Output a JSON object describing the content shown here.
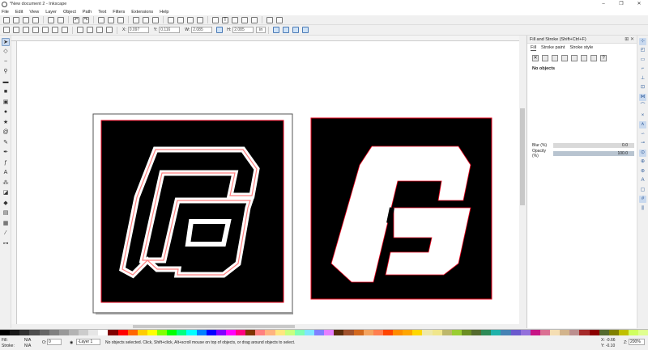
{
  "window": {
    "title": "*New document 2 - Inkscape",
    "min": "–",
    "max": "❐",
    "close": "✕"
  },
  "menu": [
    "File",
    "Edit",
    "View",
    "Layer",
    "Object",
    "Path",
    "Text",
    "Filters",
    "Extensions",
    "Help"
  ],
  "controls": {
    "x_label": "X:",
    "x_value": "0.097",
    "y_label": "Y:",
    "y_value": "0.116",
    "w_label": "W:",
    "w_value": "2.085",
    "h_label": "H:",
    "h_value": "2.085",
    "unit": "in"
  },
  "dock": {
    "title": "Fill and Stroke (Shift+Ctrl+F)",
    "tabs": [
      "Fill",
      "Stroke paint",
      "Stroke style"
    ],
    "no_objects": "No objects",
    "blur_label": "Blur (%)",
    "blur_value": "0.0",
    "opacity_label": "Opacity (%)",
    "opacity_value": "100.0"
  },
  "status": {
    "fill_label": "Fill:",
    "fill_value": "N/A",
    "stroke_label": "Stroke:",
    "stroke_value": "N/A",
    "o_label": "O:",
    "o_value": "0",
    "layer": "-Layer 1",
    "message": "No objects selected. Click, Shift+click, Alt+scroll mouse on top of objects, or drag around objects to select.",
    "x_coord": "X: -0.66",
    "y_coord": "Y: -0.10",
    "z_label": "Z:",
    "zoom": "200%"
  },
  "colors": {
    "accent": "#4a7ab6",
    "stroke_red": "#e8001c",
    "canvas": "#ffffff"
  },
  "palette": [
    "#000000",
    "#1a1a1a",
    "#333333",
    "#4d4d4d",
    "#666666",
    "#808080",
    "#999999",
    "#b3b3b3",
    "#cccccc",
    "#e6e6e6",
    "#ffffff",
    "#800000",
    "#ff0000",
    "#ff6600",
    "#ffcc00",
    "#ffff00",
    "#80ff00",
    "#00ff00",
    "#00ff80",
    "#00ffff",
    "#0080ff",
    "#0000ff",
    "#8000ff",
    "#ff00ff",
    "#ff0080",
    "#803300",
    "#ff8080",
    "#ffb380",
    "#ffe680",
    "#c8ff80",
    "#80ffb3",
    "#80e6ff",
    "#8080ff",
    "#e680ff",
    "#5a2d0c",
    "#a0522d",
    "#d2691e",
    "#f4a460",
    "#ff7f50",
    "#ff4500",
    "#ff8c00",
    "#ffa500",
    "#ffd700",
    "#eee8aa",
    "#f0e68c",
    "#bdb76b",
    "#9acd32",
    "#6b8e23",
    "#556b2f",
    "#2e8b57",
    "#20b2aa",
    "#4682b4",
    "#6a5acd",
    "#9370db",
    "#c71585",
    "#db7093",
    "#f5deb3",
    "#d2b48c",
    "#bc8f8f",
    "#a52a2a",
    "#8b0000",
    "#556b2f",
    "#808000",
    "#c0c000",
    "#d0ff60",
    "#e0ff90"
  ]
}
